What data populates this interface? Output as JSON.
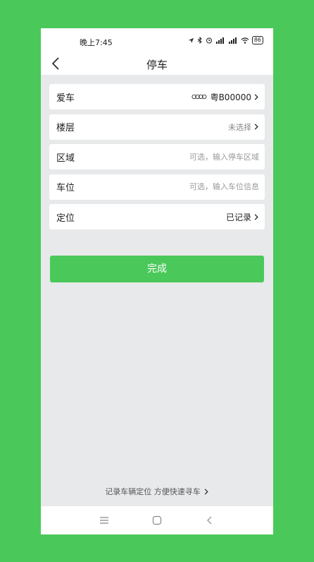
{
  "statusbar": {
    "time": "晚上7:45",
    "battery": "86"
  },
  "header": {
    "title": "停车"
  },
  "rows": [
    {
      "label": "爱车",
      "value": "粤B00000"
    },
    {
      "label": "楼层",
      "value": "未选择"
    },
    {
      "label": "区域",
      "placeholder": "可选，输入停车区域"
    },
    {
      "label": "车位",
      "placeholder": "可选，输入车位信息"
    },
    {
      "label": "定位",
      "value": "已记录"
    }
  ],
  "done_button": "完成",
  "footer_tip": "记录车辆定位 方便快速寻车",
  "colors": {
    "accent": "#4ac95a",
    "background": "#e7e9ea"
  },
  "icons": [
    "back-arrow-icon",
    "audi-logo-icon",
    "chevron-right-icon",
    "menu-icon",
    "home-icon",
    "back-icon"
  ]
}
